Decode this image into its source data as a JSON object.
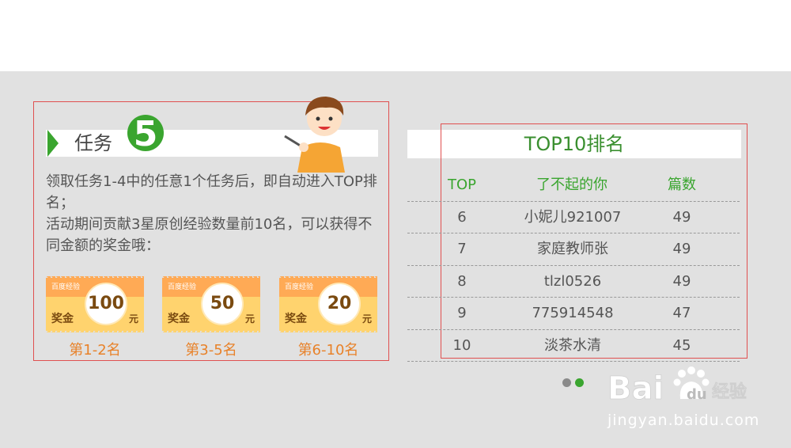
{
  "task": {
    "title": "任务",
    "number": "5",
    "description_lines": [
      "领取任务1-4中的任意1个任务后，即自动进入TOP排名；",
      "活动期间贡献3星原创经验数量前10名，可以获得不同金额的奖金哦："
    ],
    "vouchers": [
      {
        "brand": "百度经验",
        "label": "奖金",
        "amount": "100",
        "unit": "元",
        "caption": "第1-2名"
      },
      {
        "brand": "百度经验",
        "label": "奖金",
        "amount": "50",
        "unit": "元",
        "caption": "第3-5名"
      },
      {
        "brand": "百度经验",
        "label": "奖金",
        "amount": "20",
        "unit": "元",
        "caption": "第6-10名"
      }
    ]
  },
  "ranking": {
    "title": "TOP10排名",
    "headers": [
      "TOP",
      "了不起的你",
      "篇数"
    ],
    "rows": [
      [
        "6",
        "小妮儿921007",
        "49"
      ],
      [
        "7",
        "家庭教师张",
        "49"
      ],
      [
        "8",
        "tlzl0526",
        "49"
      ],
      [
        "9",
        "775914548",
        "47"
      ],
      [
        "10",
        "淡茶水清",
        "45"
      ]
    ],
    "pager": {
      "count": 2,
      "active": 2
    }
  },
  "watermark": {
    "url": "jingyan.baidu.com"
  },
  "colors": {
    "accent_green": "#3aa52f",
    "voucher_orange": "#ffaa55",
    "voucher_yellow": "#ffd36e",
    "caption_orange": "#e8822a",
    "frame_red": "#e05050"
  }
}
